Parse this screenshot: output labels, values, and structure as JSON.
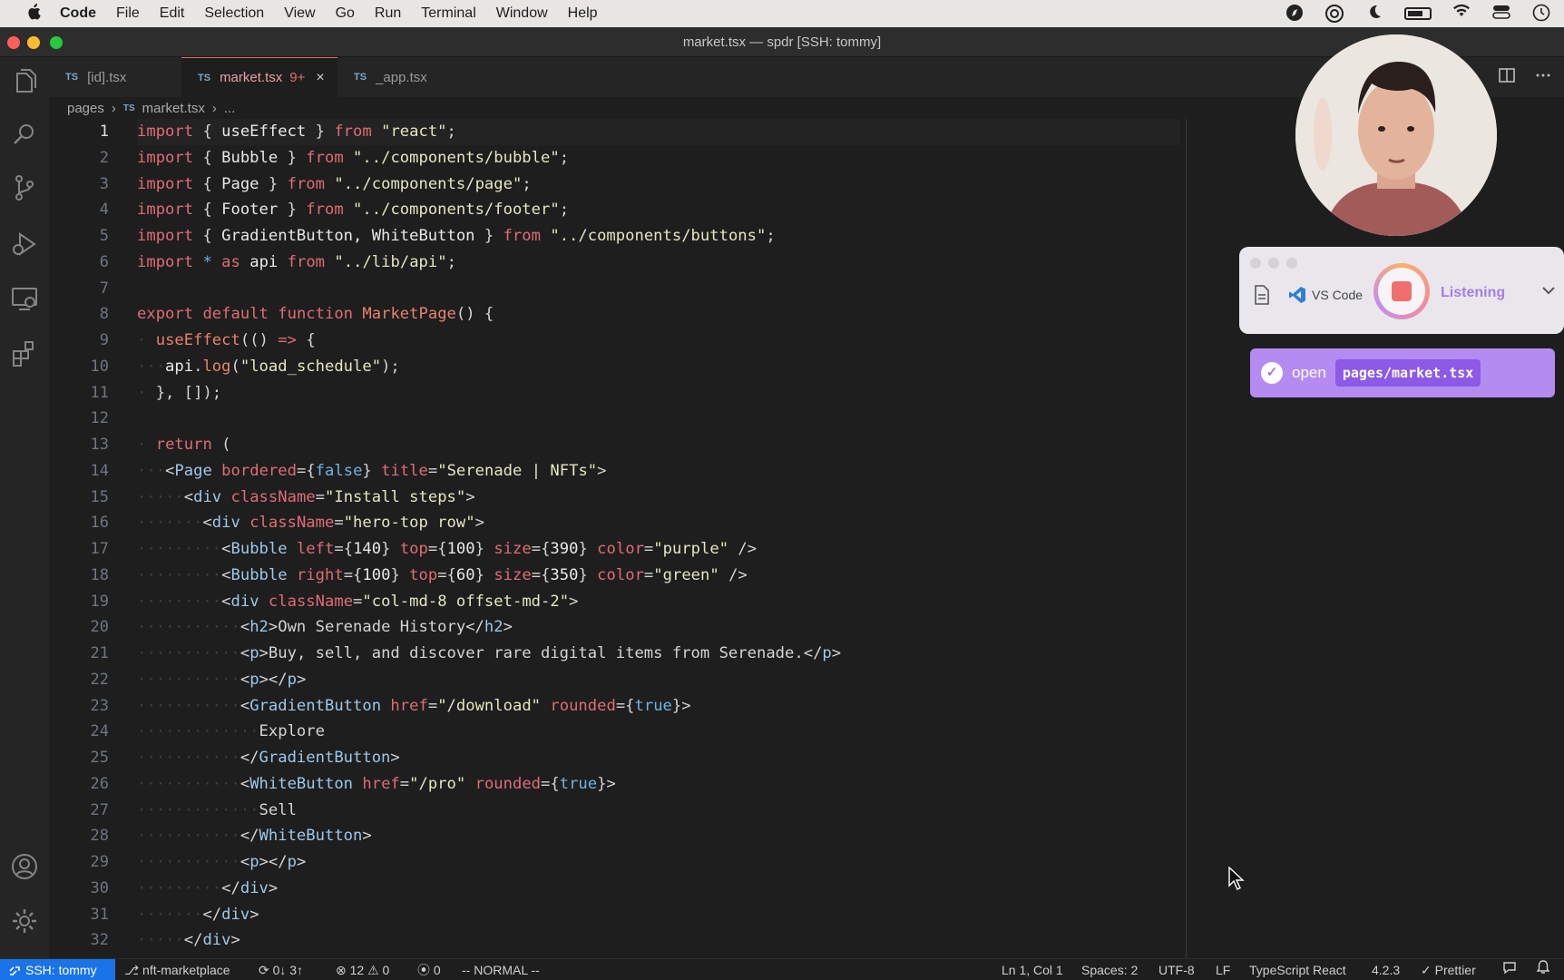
{
  "menubar": {
    "app": "Code",
    "items": [
      "File",
      "Edit",
      "Selection",
      "View",
      "Go",
      "Run",
      "Terminal",
      "Window",
      "Help"
    ]
  },
  "window": {
    "title": "market.tsx — spdr [SSH: tommy]"
  },
  "tabs": [
    {
      "badge": "TS",
      "label": "[id].tsx"
    },
    {
      "badge": "TS",
      "label": "market.tsx",
      "problems": "9+",
      "close": "×"
    },
    {
      "badge": "TS",
      "label": "_app.tsx"
    }
  ],
  "breadcrumb": {
    "folder": "pages",
    "badge": "TS",
    "file": "market.tsx",
    "rest": "..."
  },
  "editor": {
    "current_line": 1,
    "line_numbers": [
      "1",
      "2",
      "3",
      "4",
      "5",
      "6",
      "7",
      "8",
      "9",
      "10",
      "11",
      "12",
      "13",
      "14",
      "15",
      "16",
      "17",
      "18",
      "19",
      "20",
      "21",
      "22",
      "23",
      "24",
      "25",
      "26",
      "27",
      "28",
      "29",
      "30",
      "31",
      "32"
    ]
  },
  "widget": {
    "app": "VS Code",
    "status": "Listening",
    "accent": "#a57ee6"
  },
  "command": {
    "verb": "open",
    "argument": "pages/market.tsx"
  },
  "statusbar": {
    "remote": "SSH: tommy",
    "branch": "nft-marketplace",
    "sync": "0↓ 3↑",
    "errors": "12",
    "warnings": "0",
    "ports": "0",
    "mode": "-- NORMAL --",
    "position": "Ln 1, Col 1",
    "spaces": "Spaces: 2",
    "encoding": "UTF-8",
    "eol": "LF",
    "language": "TypeScript React",
    "version": "4.2.3",
    "formatter": "Prettier"
  },
  "colors": {
    "remote_bg": "#1a73e8",
    "active_tab_border": "#e06c6c"
  }
}
